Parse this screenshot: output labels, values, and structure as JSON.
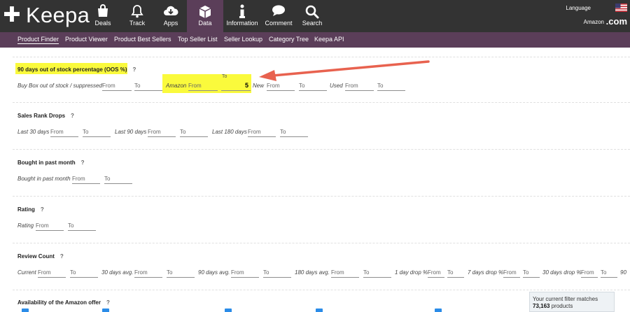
{
  "brand": {
    "name": "Keepa"
  },
  "nav": [
    {
      "label": "Deals",
      "icon": "shopping-bag-icon",
      "active": false
    },
    {
      "label": "Track",
      "icon": "bell-icon",
      "active": false
    },
    {
      "label": "Apps",
      "icon": "cloud-download-icon",
      "active": false
    },
    {
      "label": "Data",
      "icon": "box-icon",
      "active": true
    },
    {
      "label": "Information",
      "icon": "info-icon",
      "active": false
    },
    {
      "label": "Comment",
      "icon": "chat-bubble-icon",
      "active": false
    },
    {
      "label": "Search",
      "icon": "search-icon",
      "active": false
    }
  ],
  "header_right": {
    "language": "Language",
    "marketplace": "Amazon",
    "domain": ".com",
    "flag_icon": "us-flag-icon"
  },
  "subnav": [
    {
      "label": "Product Finder",
      "active": true
    },
    {
      "label": "Product Viewer",
      "active": false
    },
    {
      "label": "Product Best Sellers",
      "active": false
    },
    {
      "label": "Top Seller List",
      "active": false
    },
    {
      "label": "Seller Lookup",
      "active": false
    },
    {
      "label": "Category Tree",
      "active": false
    },
    {
      "label": "Keepa API",
      "active": false
    }
  ],
  "oos": {
    "title": "90 days out of stock percentage (OOS %)",
    "help": "?",
    "buybox_label": "Buy Box out of stock / suppressed",
    "amazon_label": "Amazon",
    "to_top_label": "To",
    "amazon_to_value": "5",
    "new_label": "New",
    "used_label": "Used",
    "from": "From",
    "to": "To"
  },
  "sales_rank": {
    "title": "Sales Rank Drops",
    "help": "?",
    "last30": "Last 30 days",
    "last90": "Last 90 days",
    "last180": "Last 180 days",
    "from": "From",
    "to": "To"
  },
  "bought": {
    "title": "Bought in past month",
    "help": "?",
    "label": "Bought in past month",
    "from": "From",
    "to": "To"
  },
  "rating": {
    "title": "Rating",
    "help": "?",
    "label": "Rating",
    "from": "From",
    "to": "To"
  },
  "review_count": {
    "title": "Review Count",
    "help": "?",
    "current": "Current",
    "avg30": "30 days avg.",
    "avg90": "90 days avg.",
    "avg180": "180 days avg.",
    "drop1": "1 day drop %",
    "drop7": "7 days drop %",
    "drop30": "30 days drop %",
    "trunc": "90",
    "from": "From",
    "to": "To"
  },
  "availability": {
    "title": "Availability of the Amazon offer",
    "help": "?"
  },
  "match": {
    "prefix": "Your current filter matches",
    "count": "73,163",
    "suffix": "products"
  },
  "colors": {
    "topbar": "#333333",
    "accent": "#5b3e59",
    "highlight": "#fafa3c",
    "arrow": "#e8624f",
    "checkbox": "#2b8ce8"
  }
}
